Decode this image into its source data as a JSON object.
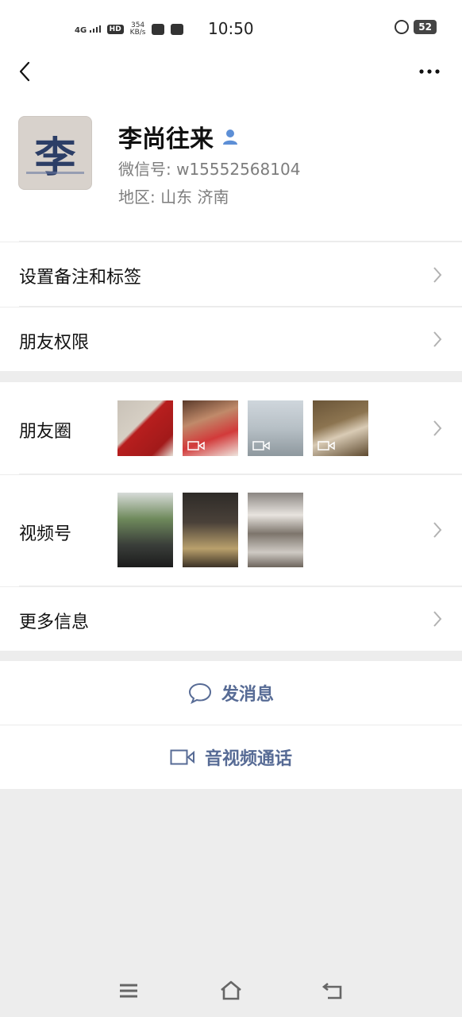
{
  "status_bar": {
    "network": "4G",
    "hd": "HD",
    "speed_value": "354",
    "speed_unit": "KB/s",
    "time": "10:50",
    "battery": "52"
  },
  "profile": {
    "name": "李尚往来",
    "wechat_id": "微信号: w15552568104",
    "region": "地区: 山东  济南",
    "avatar_glyph": "李"
  },
  "menu": {
    "remark_tags": "设置备注和标签",
    "friend_permissions": "朋友权限",
    "moments": "朋友圈",
    "channels": "视频号",
    "more_info": "更多信息"
  },
  "actions": {
    "send_message": "发消息",
    "av_call": "音视频通话"
  },
  "colors": {
    "link_blue": "#576b95",
    "background_gray": "#ededed"
  }
}
